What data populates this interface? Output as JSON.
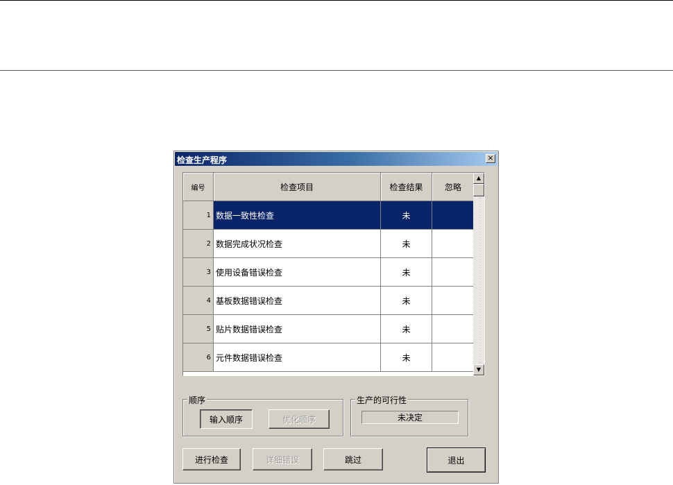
{
  "dialog": {
    "title": "检查生产程序",
    "close_symbol": "×"
  },
  "grid": {
    "columns": [
      "编号",
      "检查项目",
      "检查结果",
      "忽略"
    ],
    "rows": [
      {
        "num": "1",
        "item": "数据一致性检查",
        "result": "未",
        "ignore": ""
      },
      {
        "num": "2",
        "item": "数据完成状况检查",
        "result": "未",
        "ignore": ""
      },
      {
        "num": "3",
        "item": "使用设备错误检查",
        "result": "未",
        "ignore": ""
      },
      {
        "num": "4",
        "item": "基板数据错误检查",
        "result": "未",
        "ignore": ""
      },
      {
        "num": "5",
        "item": "贴片数据错误检查",
        "result": "未",
        "ignore": ""
      },
      {
        "num": "6",
        "item": "元件数据错误检查",
        "result": "未",
        "ignore": ""
      }
    ],
    "selected_row": 1,
    "scroll_up_symbol": "▲",
    "scroll_down_symbol": "▼"
  },
  "order_group": {
    "label": "顺序",
    "input_order": "输入顺序",
    "optimize_order": "优化顺序"
  },
  "feasibility_group": {
    "label": "生产的可行性",
    "status": "未决定"
  },
  "buttons": {
    "run_check": "进行检查",
    "detail_errors": "详细错误",
    "skip": "跳过",
    "exit": "退出"
  }
}
